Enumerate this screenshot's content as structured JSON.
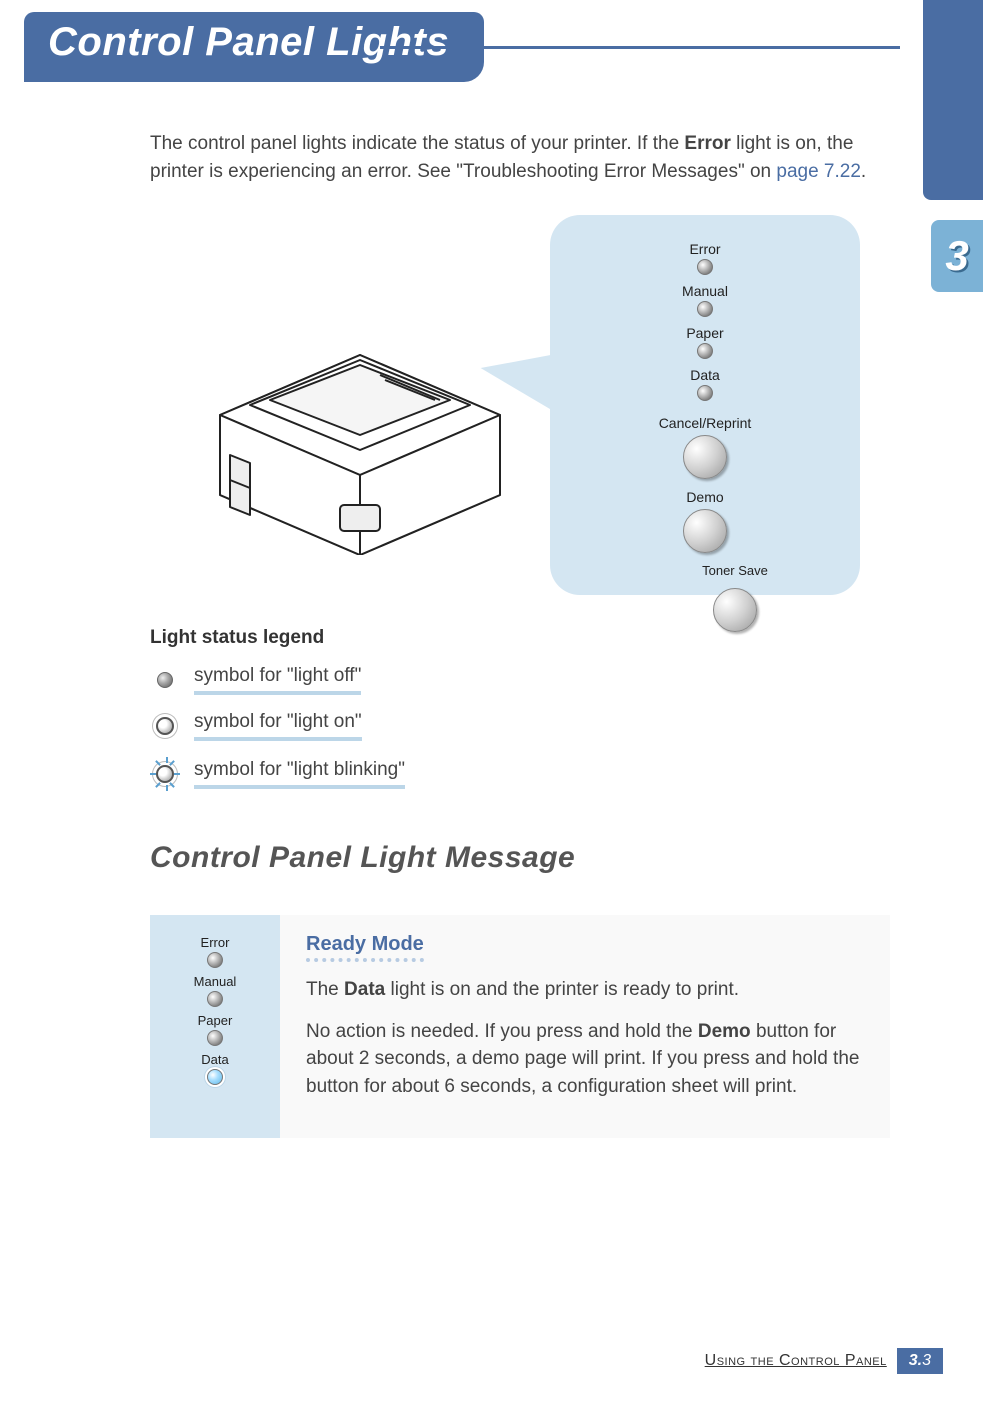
{
  "header": {
    "title": "Control Panel Lights"
  },
  "thumb": {
    "number": "3"
  },
  "intro": {
    "t1": "The control panel lights indicate the status of your printer. If the ",
    "bold1": "Error",
    "t2": " light is on, the printer is experiencing an error. See \"Troubleshooting Error Messages\" on ",
    "link": "page 7.22",
    "t3": "."
  },
  "panel": {
    "lights": [
      "Error",
      "Manual",
      "Paper",
      "Data"
    ],
    "buttons": {
      "cancel": "Cancel/Reprint",
      "demo": "Demo",
      "toner": "Toner Save"
    }
  },
  "legend": {
    "title": "Light status legend",
    "off": "symbol for \"light off\"",
    "on": "symbol for \"light on\"",
    "blink": "symbol for \"light blinking\""
  },
  "section": {
    "title": "Control Panel Light Message"
  },
  "message": {
    "side_lights": [
      "Error",
      "Manual",
      "Paper",
      "Data"
    ],
    "heading": "Ready Mode",
    "p1a": "The ",
    "p1b": "Data",
    "p1c": " light is on and the printer is ready to print.",
    "p2a": "No action is needed. If you press and hold the ",
    "p2b": "Demo",
    "p2c": " button for about 2 seconds, a demo page will print. If you press and hold the button for about 6 seconds, a configuration sheet will print."
  },
  "footer": {
    "text": "Using the Control Panel",
    "page_chapter": "3.",
    "page_num": "3"
  }
}
